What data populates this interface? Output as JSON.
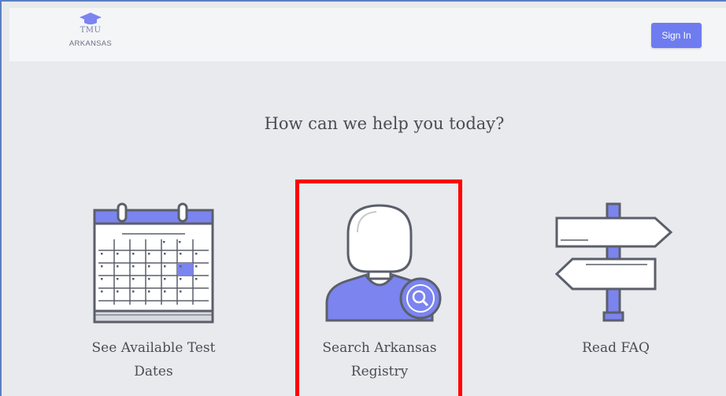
{
  "header": {
    "logo_line1": "TMU",
    "logo_line2": "ARKANSAS",
    "signin_label": "Sign In"
  },
  "main": {
    "headline": "How can we help you today?",
    "options": [
      {
        "line1": "See Available Test",
        "line2": "Dates",
        "icon": "calendar-icon"
      },
      {
        "line1": "Search Arkansas",
        "line2": "Registry",
        "icon": "person-search-icon"
      },
      {
        "line1": "Read FAQ",
        "line2": "",
        "icon": "signpost-icon"
      }
    ]
  },
  "colors": {
    "accent": "#6e7cf0",
    "background": "#e8eaee",
    "header_bg": "#f4f5f7",
    "highlight": "#ff0000",
    "text": "#4a4c55"
  }
}
